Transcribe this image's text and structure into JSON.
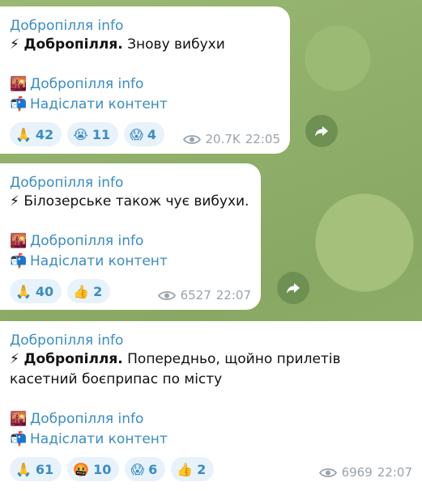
{
  "messages": [
    {
      "channel": "Добропілля info",
      "bolt": "⚡",
      "bold": "Добропілля.",
      "text": " Знову вибухи",
      "link1_icon": "🌇",
      "link1": "Добропілля info",
      "link2_icon": "📬",
      "link2": "Надіслати контент",
      "reactions": [
        {
          "emoji": "🙏",
          "count": "42"
        },
        {
          "emoji": "😭",
          "count": "11"
        },
        {
          "emoji": "😱",
          "count": "4"
        }
      ],
      "views": "20.7K",
      "time": "22:05"
    },
    {
      "channel": "Добропілля info",
      "bolt": "⚡",
      "bold": "",
      "text": "Білозерське також чує вибухи.",
      "link1_icon": "🌇",
      "link1": "Добропілля info",
      "link2_icon": "📬",
      "link2": "Надіслати контент",
      "reactions": [
        {
          "emoji": "🙏",
          "count": "40"
        },
        {
          "emoji": "👍",
          "count": "2"
        }
      ],
      "views": "6527",
      "time": "22:07"
    },
    {
      "channel": "Добропілля info",
      "bolt": "⚡",
      "bold": "Добропілля.",
      "text": " Попередньо, щойно прилетів касетний боєприпас по місту",
      "link1_icon": "🌇",
      "link1": "Добропілля info",
      "link2_icon": "📬",
      "link2": "Надіслати контент",
      "reactions": [
        {
          "emoji": "🙏",
          "count": "61"
        },
        {
          "emoji": "🤬",
          "count": "10"
        },
        {
          "emoji": "😱",
          "count": "6"
        },
        {
          "emoji": "👍",
          "count": "2"
        }
      ],
      "views": "6969",
      "time": "22:07"
    }
  ],
  "colors": {
    "accent": "#3a8cc4",
    "bubble": "#ffffff",
    "wallpaper": "#8fae6a",
    "forward_button": "#6e9153"
  }
}
